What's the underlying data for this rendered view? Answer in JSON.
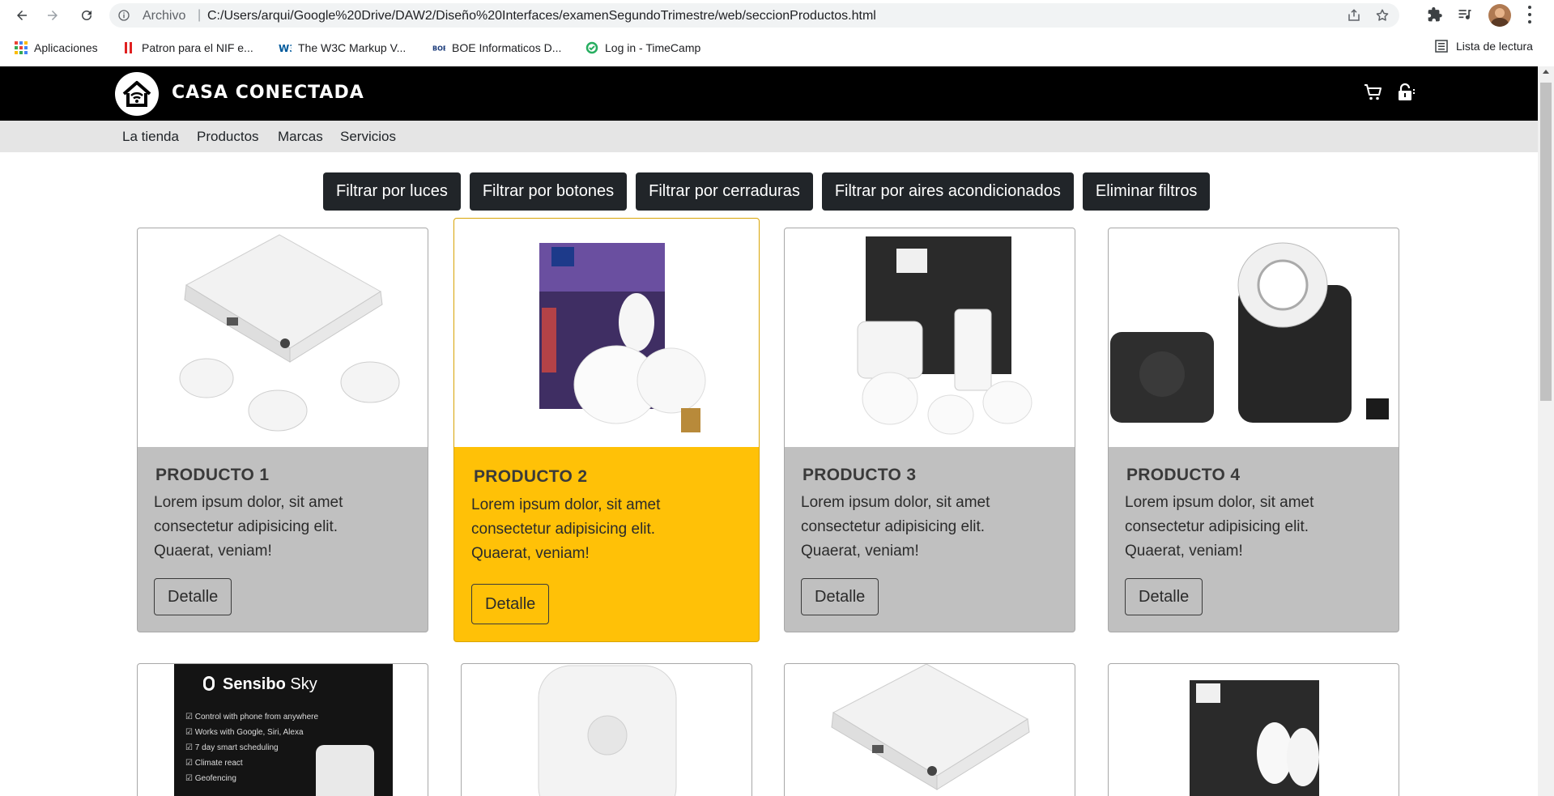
{
  "browser": {
    "omnibox_label": "Archivo",
    "omnibox_separator": "|",
    "url": "C:/Users/arqui/Google%20Drive/DAW2/Diseño%20Interfaces/examenSegundoTrimestre/web/seccionProductos.html"
  },
  "bookmarks": {
    "items": [
      {
        "label": "Aplicaciones",
        "icon": "apps-grid-icon"
      },
      {
        "label": "Patron para el NIF e...",
        "icon": "red-bars-icon"
      },
      {
        "label": "The W3C Markup V...",
        "icon": "w3c-icon"
      },
      {
        "label": "BOE Informaticos D...",
        "icon": "boe-icon"
      },
      {
        "label": "Log in - TimeCamp",
        "icon": "timecamp-icon"
      }
    ],
    "reading_list": "Lista de lectura"
  },
  "site": {
    "brand": "CASA CONECTADA",
    "nav": [
      "La tienda",
      "Productos",
      "Marcas",
      "Servicios"
    ],
    "filters": [
      "Filtrar por luces",
      "Filtrar por botones",
      "Filtrar por cerraduras",
      "Filtrar por aires acondicionados",
      "Eliminar filtros"
    ],
    "detail_label": "Detalle",
    "description": "Lorem ipsum dolor, sit amet consectetur adipisicing elit. Quaerat, veniam!",
    "desc_lines": [
      "Lorem ipsum dolor, sit amet",
      "consectetur adipisicing elit.",
      "Quaerat, veniam!"
    ],
    "products": [
      {
        "title": "PRODUCTO 1",
        "image": "flic-buttons-hub"
      },
      {
        "title": "PRODUCTO 2",
        "image": "philips-hue-color-kit",
        "highlighted": true
      },
      {
        "title": "PRODUCTO 3",
        "image": "philips-hue-white-kit"
      },
      {
        "title": "PRODUCTO 4",
        "image": "nuki-smart-lock"
      }
    ],
    "sensibo": {
      "brand": "Sensibo",
      "model": "Sky",
      "features": [
        "Control with phone from anywhere",
        "Works with Google, Siri, Alexa",
        "7 day smart scheduling",
        "Climate react",
        "Geofencing"
      ]
    },
    "accent_color": "#ffc107",
    "header_color": "#000000"
  }
}
